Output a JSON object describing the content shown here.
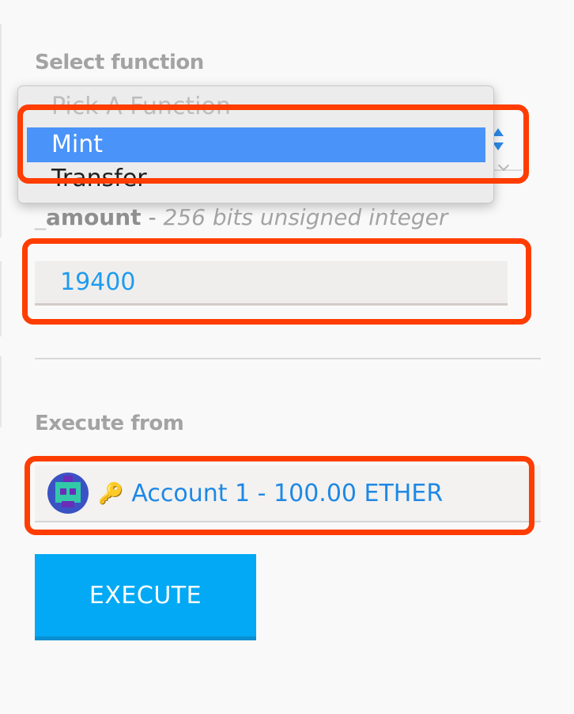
{
  "form": {
    "select_function_label": "Select function",
    "function_options": [
      {
        "label": "Pick A Function",
        "state": "placeholder"
      },
      {
        "label": "Mint",
        "state": "selected"
      },
      {
        "label": "Transfer",
        "state": "normal"
      }
    ],
    "amount": {
      "prefix": "_",
      "arg_name": "amount",
      "separator": " - ",
      "type_desc": "256 bits unsigned integer",
      "value": "19400"
    },
    "execute_from_label": "Execute from",
    "account": {
      "label": "Account 1 - 100.00 ETHER",
      "key_icon": "key-icon",
      "avatar": "identicon-avatar"
    },
    "execute_button": "EXECUTE"
  },
  "colors": {
    "highlight": "#ff3d00",
    "accent": "#03a9f4",
    "selected_option": "#4a93f8",
    "value_text": "#1e9cf0"
  }
}
